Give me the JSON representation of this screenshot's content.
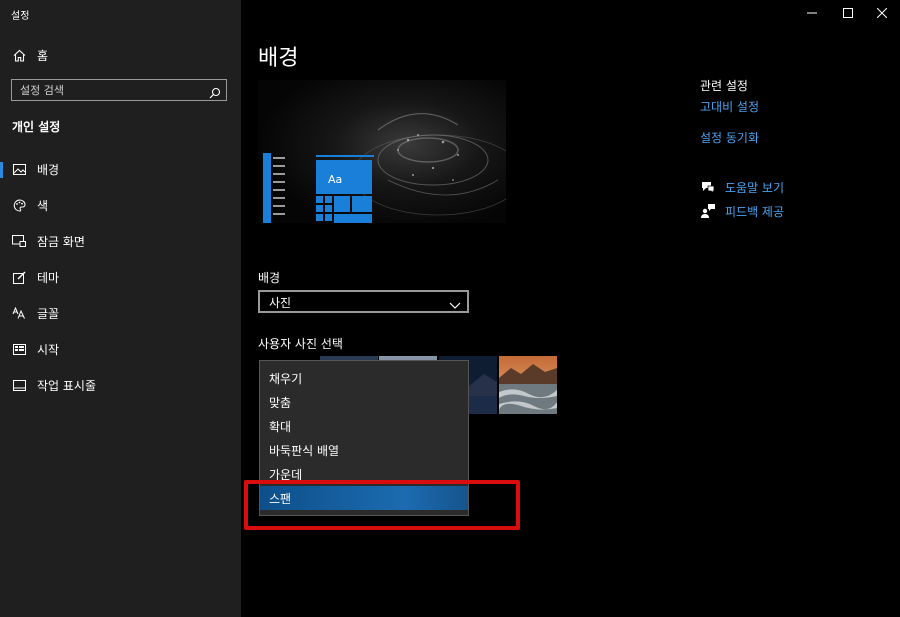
{
  "window": {
    "title": "설정",
    "controls": [
      "minimize-icon",
      "maximize-icon",
      "close-icon"
    ]
  },
  "sidebar": {
    "home_label": "홈",
    "search_placeholder": "설정 검색",
    "section_title": "개인 설정",
    "items": [
      {
        "label": "배경",
        "icon": "picture-icon",
        "active": true
      },
      {
        "label": "색",
        "icon": "palette-icon",
        "active": false
      },
      {
        "label": "잠금 화면",
        "icon": "lock-screen-icon",
        "active": false
      },
      {
        "label": "테마",
        "icon": "theme-brush-icon",
        "active": false
      },
      {
        "label": "글꼴",
        "icon": "font-icon",
        "active": false
      },
      {
        "label": "시작",
        "icon": "start-menu-icon",
        "active": false
      },
      {
        "label": "작업 표시줄",
        "icon": "taskbar-icon",
        "active": false
      }
    ],
    "accent_color": "#2b8ae0"
  },
  "main": {
    "title": "배경",
    "preview": {
      "tile_text": "Aa",
      "tile_color": "#1a7fd9"
    },
    "background_label": "배경",
    "background_value": "사진",
    "photo_label": "사용자 사진 선택",
    "fit_options": [
      {
        "label": "채우기",
        "selected": false
      },
      {
        "label": "맞춤",
        "selected": false
      },
      {
        "label": "확대",
        "selected": false
      },
      {
        "label": "바둑판식 배열",
        "selected": false
      },
      {
        "label": "가운데",
        "selected": false
      },
      {
        "label": "스팬",
        "selected": true
      }
    ],
    "highlight_color": "#d90d0d"
  },
  "related": {
    "title": "관련 설정",
    "links": [
      "고대비 설정",
      "설정 동기화"
    ],
    "help": [
      {
        "label": "도움말 보기",
        "icon": "help-chat-icon"
      },
      {
        "label": "피드백 제공",
        "icon": "feedback-icon"
      }
    ],
    "link_color": "#4aa3f0"
  }
}
